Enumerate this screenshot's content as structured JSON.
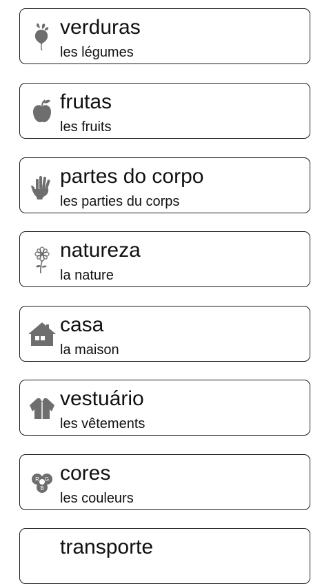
{
  "categories": [
    {
      "title": "verduras",
      "subtitle": "les légumes",
      "icon": "beet-icon"
    },
    {
      "title": "frutas",
      "subtitle": "les fruits",
      "icon": "apple-icon"
    },
    {
      "title": "partes do corpo",
      "subtitle": "les parties du corps",
      "icon": "hand-icon"
    },
    {
      "title": "natureza",
      "subtitle": "la nature",
      "icon": "flower-icon"
    },
    {
      "title": "casa",
      "subtitle": "la maison",
      "icon": "house-icon"
    },
    {
      "title": "vestuário",
      "subtitle": "les vêtements",
      "icon": "jacket-icon"
    },
    {
      "title": "cores",
      "subtitle": "les couleurs",
      "icon": "rgb-circles-icon"
    },
    {
      "title": "transporte",
      "subtitle": "",
      "icon": ""
    }
  ],
  "colors": {
    "icon_gray": "#6e6e6e",
    "text": "#111111",
    "border": "#1a1a1a"
  }
}
